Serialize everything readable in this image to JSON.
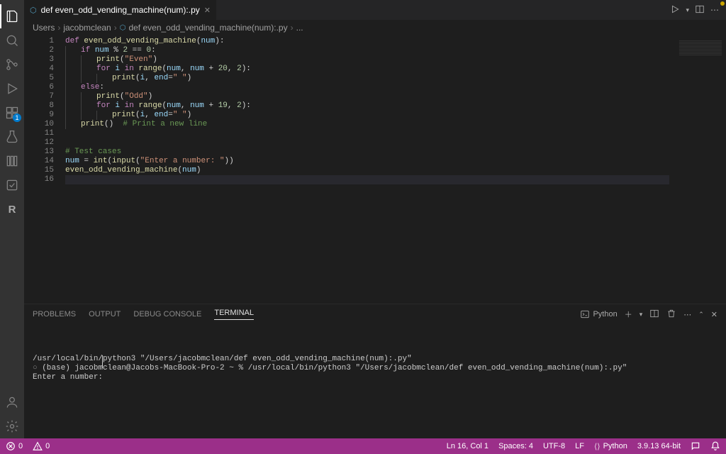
{
  "tab": {
    "filename": "def even_odd_vending_machine(num):.py"
  },
  "breadcrumb": {
    "segments": [
      "Users",
      "jacobmclean",
      "def even_odd_vending_machine(num):.py",
      "..."
    ]
  },
  "code": {
    "lines": [
      {
        "n": 1,
        "indent": 0,
        "tokens": [
          {
            "t": "def ",
            "c": "kw"
          },
          {
            "t": "even_odd_vending_machine",
            "c": "fn"
          },
          {
            "t": "(",
            "c": "op"
          },
          {
            "t": "num",
            "c": "var"
          },
          {
            "t": "):",
            "c": "op"
          }
        ]
      },
      {
        "n": 2,
        "indent": 1,
        "tokens": [
          {
            "t": "if ",
            "c": "kw"
          },
          {
            "t": "num",
            "c": "var"
          },
          {
            "t": " % ",
            "c": "op"
          },
          {
            "t": "2",
            "c": "num"
          },
          {
            "t": " == ",
            "c": "op"
          },
          {
            "t": "0",
            "c": "num"
          },
          {
            "t": ":",
            "c": "op"
          }
        ]
      },
      {
        "n": 3,
        "indent": 2,
        "tokens": [
          {
            "t": "print",
            "c": "builtin"
          },
          {
            "t": "(",
            "c": "op"
          },
          {
            "t": "\"Even\"",
            "c": "str"
          },
          {
            "t": ")",
            "c": "op"
          }
        ]
      },
      {
        "n": 4,
        "indent": 2,
        "tokens": [
          {
            "t": "for ",
            "c": "kw"
          },
          {
            "t": "i",
            "c": "var"
          },
          {
            "t": " in ",
            "c": "kw"
          },
          {
            "t": "range",
            "c": "builtin"
          },
          {
            "t": "(",
            "c": "op"
          },
          {
            "t": "num",
            "c": "var"
          },
          {
            "t": ", ",
            "c": "op"
          },
          {
            "t": "num",
            "c": "var"
          },
          {
            "t": " + ",
            "c": "op"
          },
          {
            "t": "20",
            "c": "num"
          },
          {
            "t": ", ",
            "c": "op"
          },
          {
            "t": "2",
            "c": "num"
          },
          {
            "t": "):",
            "c": "op"
          }
        ]
      },
      {
        "n": 5,
        "indent": 3,
        "tokens": [
          {
            "t": "print",
            "c": "builtin"
          },
          {
            "t": "(",
            "c": "op"
          },
          {
            "t": "i",
            "c": "var"
          },
          {
            "t": ", ",
            "c": "op"
          },
          {
            "t": "end",
            "c": "var"
          },
          {
            "t": "=",
            "c": "op"
          },
          {
            "t": "\" \"",
            "c": "str"
          },
          {
            "t": ")",
            "c": "op"
          }
        ]
      },
      {
        "n": 6,
        "indent": 1,
        "tokens": [
          {
            "t": "else",
            "c": "kw"
          },
          {
            "t": ":",
            "c": "op"
          }
        ]
      },
      {
        "n": 7,
        "indent": 2,
        "tokens": [
          {
            "t": "print",
            "c": "builtin"
          },
          {
            "t": "(",
            "c": "op"
          },
          {
            "t": "\"Odd\"",
            "c": "str"
          },
          {
            "t": ")",
            "c": "op"
          }
        ]
      },
      {
        "n": 8,
        "indent": 2,
        "tokens": [
          {
            "t": "for ",
            "c": "kw"
          },
          {
            "t": "i",
            "c": "var"
          },
          {
            "t": " in ",
            "c": "kw"
          },
          {
            "t": "range",
            "c": "builtin"
          },
          {
            "t": "(",
            "c": "op"
          },
          {
            "t": "num",
            "c": "var"
          },
          {
            "t": ", ",
            "c": "op"
          },
          {
            "t": "num",
            "c": "var"
          },
          {
            "t": " + ",
            "c": "op"
          },
          {
            "t": "19",
            "c": "num"
          },
          {
            "t": ", ",
            "c": "op"
          },
          {
            "t": "2",
            "c": "num"
          },
          {
            "t": "):",
            "c": "op"
          }
        ]
      },
      {
        "n": 9,
        "indent": 3,
        "tokens": [
          {
            "t": "print",
            "c": "builtin"
          },
          {
            "t": "(",
            "c": "op"
          },
          {
            "t": "i",
            "c": "var"
          },
          {
            "t": ", ",
            "c": "op"
          },
          {
            "t": "end",
            "c": "var"
          },
          {
            "t": "=",
            "c": "op"
          },
          {
            "t": "\" \"",
            "c": "str"
          },
          {
            "t": ")",
            "c": "op"
          }
        ]
      },
      {
        "n": 10,
        "indent": 1,
        "tokens": [
          {
            "t": "print",
            "c": "builtin"
          },
          {
            "t": "()  ",
            "c": "op"
          },
          {
            "t": "# Print a new line",
            "c": "com"
          }
        ]
      },
      {
        "n": 11,
        "indent": 0,
        "tokens": []
      },
      {
        "n": 12,
        "indent": 0,
        "tokens": []
      },
      {
        "n": 13,
        "indent": 0,
        "tokens": [
          {
            "t": "# Test cases",
            "c": "com"
          }
        ]
      },
      {
        "n": 14,
        "indent": 0,
        "tokens": [
          {
            "t": "num",
            "c": "var"
          },
          {
            "t": " = ",
            "c": "op"
          },
          {
            "t": "int",
            "c": "builtin"
          },
          {
            "t": "(",
            "c": "op"
          },
          {
            "t": "input",
            "c": "builtin"
          },
          {
            "t": "(",
            "c": "op"
          },
          {
            "t": "\"Enter a number: \"",
            "c": "str"
          },
          {
            "t": "))",
            "c": "op"
          }
        ]
      },
      {
        "n": 15,
        "indent": 0,
        "tokens": [
          {
            "t": "even_odd_vending_machine",
            "c": "fn"
          },
          {
            "t": "(",
            "c": "op"
          },
          {
            "t": "num",
            "c": "var"
          },
          {
            "t": ")",
            "c": "op"
          }
        ]
      },
      {
        "n": 16,
        "indent": 0,
        "tokens": [],
        "hl": true
      }
    ]
  },
  "panel": {
    "tabs": [
      "PROBLEMS",
      "OUTPUT",
      "DEBUG CONSOLE",
      "TERMINAL"
    ],
    "activeTab": "TERMINAL",
    "termKind": "Python",
    "terminalLines": [
      "/usr/local/bin/python3 \"/Users/jacobmclean/def even_odd_vending_machine(num):.py\"",
      "(base) jacobmclean@Jacobs-MacBook-Pro-2 ~ % /usr/local/bin/python3 \"/Users/jacobmclean/def even_odd_vending_machine(num):.py\"",
      "Enter a number: "
    ]
  },
  "status": {
    "errors": "0",
    "warnings": "0",
    "lncol": "Ln 16, Col 1",
    "spaces": "Spaces: 4",
    "encoding": "UTF-8",
    "eol": "LF",
    "language": "Python",
    "pyversion": "3.9.13 64-bit"
  },
  "activity": {
    "extBadge": "1"
  }
}
